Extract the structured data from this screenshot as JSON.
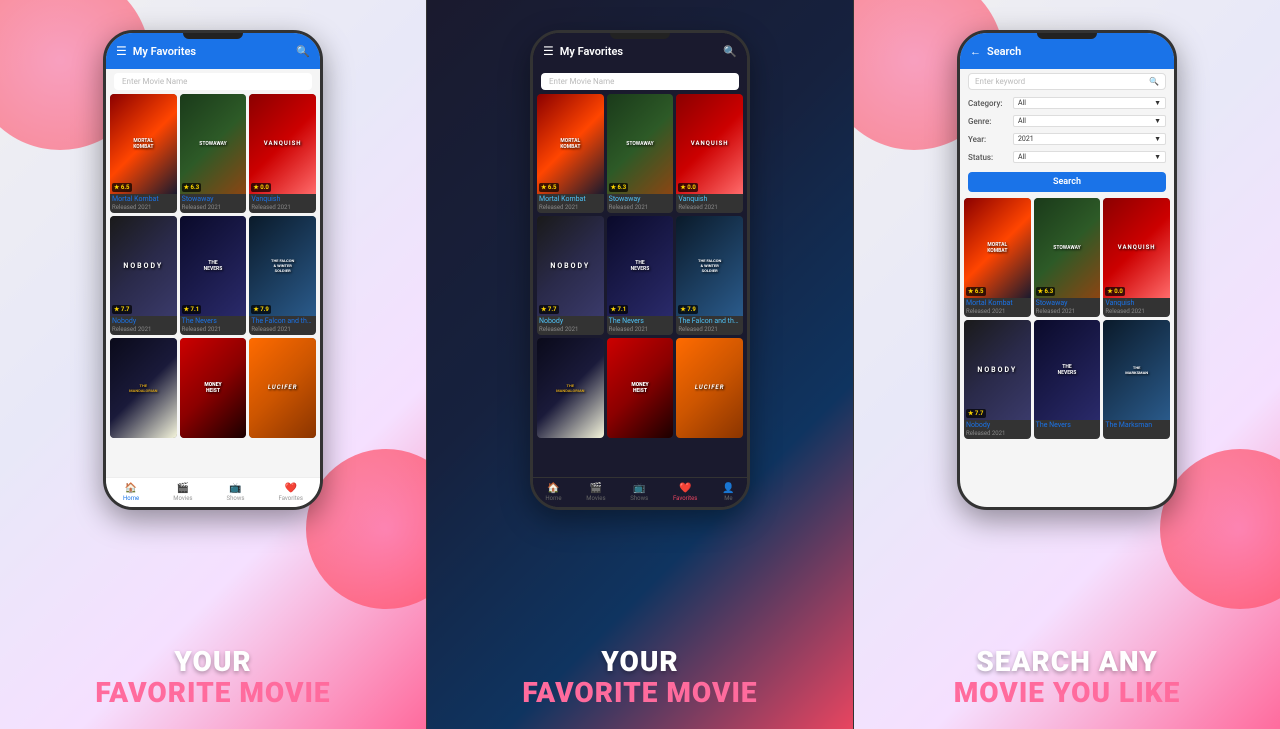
{
  "panels": [
    {
      "id": "panel-1",
      "theme": "light",
      "header": {
        "title": "My Favorites",
        "menu_icon": "☰",
        "search_icon": "🔍"
      },
      "search_placeholder": "Enter Movie Name",
      "movies": [
        {
          "title": "Mortal Kombat",
          "year": "Released 2021",
          "rating": "6.5",
          "poster_class": "mk"
        },
        {
          "title": "Stowaway",
          "year": "Released 2021",
          "rating": "6.3",
          "poster_class": "sw"
        },
        {
          "title": "Vanquish",
          "year": "Released 2021",
          "rating": "0.0",
          "poster_class": "vq"
        },
        {
          "title": "Nobody",
          "year": "Released 2021",
          "rating": "7.7",
          "poster_class": "nb"
        },
        {
          "title": "The Nevers",
          "year": "Released 2021",
          "rating": "7.1",
          "poster_class": "nv"
        },
        {
          "title": "The Falcon and the Winter Soldier",
          "year": "Released 2021",
          "rating": "7.9",
          "poster_class": "fw"
        },
        {
          "title": "Mandalorian",
          "year": "",
          "rating": "",
          "poster_class": "mn"
        },
        {
          "title": "Money Heist",
          "year": "",
          "rating": "",
          "poster_class": "mh"
        },
        {
          "title": "Lucifer",
          "year": "",
          "rating": "",
          "poster_class": "lc"
        }
      ],
      "nav": [
        {
          "icon": "🏠",
          "label": "Home",
          "active": true
        },
        {
          "icon": "🎬",
          "label": "Movies",
          "active": false
        },
        {
          "icon": "📺",
          "label": "Shows",
          "active": false
        },
        {
          "icon": "❤️",
          "label": "Favorites",
          "active": false
        }
      ],
      "caption": [
        "YOUR",
        "FAVORITE MOVIE"
      ]
    },
    {
      "id": "panel-2",
      "theme": "dark",
      "header": {
        "title": "My Favorites",
        "menu_icon": "☰",
        "search_icon": "🔍"
      },
      "search_placeholder": "Enter Movie Name",
      "movies": [
        {
          "title": "Mortal Kombat",
          "year": "Released 2021",
          "rating": "6.5",
          "poster_class": "mk"
        },
        {
          "title": "Stowaway",
          "year": "Released 2021",
          "rating": "6.3",
          "poster_class": "sw"
        },
        {
          "title": "Vanquish",
          "year": "Released 2021",
          "rating": "0.0",
          "poster_class": "vq"
        },
        {
          "title": "Nobody",
          "year": "Released 2021",
          "rating": "7.7",
          "poster_class": "nb"
        },
        {
          "title": "The Nevers",
          "year": "Released 2021",
          "rating": "7.1",
          "poster_class": "nv"
        },
        {
          "title": "The Falcon and the Winter Soldier",
          "year": "Released 2021",
          "rating": "7.9",
          "poster_class": "fw"
        },
        {
          "title": "Mandalorian",
          "year": "",
          "rating": "",
          "poster_class": "mn"
        },
        {
          "title": "Money Heist",
          "year": "",
          "rating": "",
          "poster_class": "mh"
        },
        {
          "title": "Lucifer",
          "year": "",
          "rating": "",
          "poster_class": "lc"
        }
      ],
      "nav": [
        {
          "icon": "🏠",
          "label": "Home",
          "active": false
        },
        {
          "icon": "🎬",
          "label": "Movies",
          "active": false
        },
        {
          "icon": "📺",
          "label": "Shows",
          "active": false
        },
        {
          "icon": "❤️",
          "label": "Favorites",
          "active": true
        },
        {
          "icon": "👤",
          "label": "Me",
          "active": false
        }
      ],
      "caption": [
        "YOUR",
        "FAVORITE MOVIE"
      ]
    },
    {
      "id": "panel-3",
      "theme": "search",
      "header": {
        "back_icon": "←",
        "title": "Search"
      },
      "search_placeholder": "Enter keyword",
      "search_icon": "🔍",
      "filters": [
        {
          "label": "Category:",
          "value": "All"
        },
        {
          "label": "Genre:",
          "value": "All"
        },
        {
          "label": "Year:",
          "value": "2021"
        },
        {
          "label": "Status:",
          "value": "All"
        }
      ],
      "search_button_label": "Search",
      "movies": [
        {
          "title": "Mortal Kombat",
          "year": "Released 2021",
          "rating": "6.5",
          "poster_class": "mk"
        },
        {
          "title": "Stowaway",
          "year": "Released 2021",
          "rating": "6.3",
          "poster_class": "sw"
        },
        {
          "title": "Vanquish",
          "year": "Released 2021",
          "rating": "0.0",
          "poster_class": "vq"
        },
        {
          "title": "Nobody",
          "year": "Released 2021",
          "rating": "7.7",
          "poster_class": "nb"
        },
        {
          "title": "The Nevers",
          "year": "",
          "rating": "",
          "poster_class": "nv"
        },
        {
          "title": "The Marksman",
          "year": "",
          "rating": "",
          "poster_class": "fw"
        }
      ],
      "caption": [
        "SEARCH ANY",
        "MOVIE YOU LIKE"
      ]
    }
  ],
  "movie_labels": {
    "mk_title": "MORTAL\nKOMBAT",
    "sw_title": "STOWAWAY",
    "vq_title": "VANQUISH",
    "nb_title": "NOBODY",
    "nv_title": "THE\nNEVERS",
    "fw_title": "THE FALCON\n& WINTER\nSOLDIER",
    "mn_title": "THE\nMANDALORIAN",
    "mh_title": "MONEY\nHEIST",
    "lc_title": "LUCIFER"
  }
}
